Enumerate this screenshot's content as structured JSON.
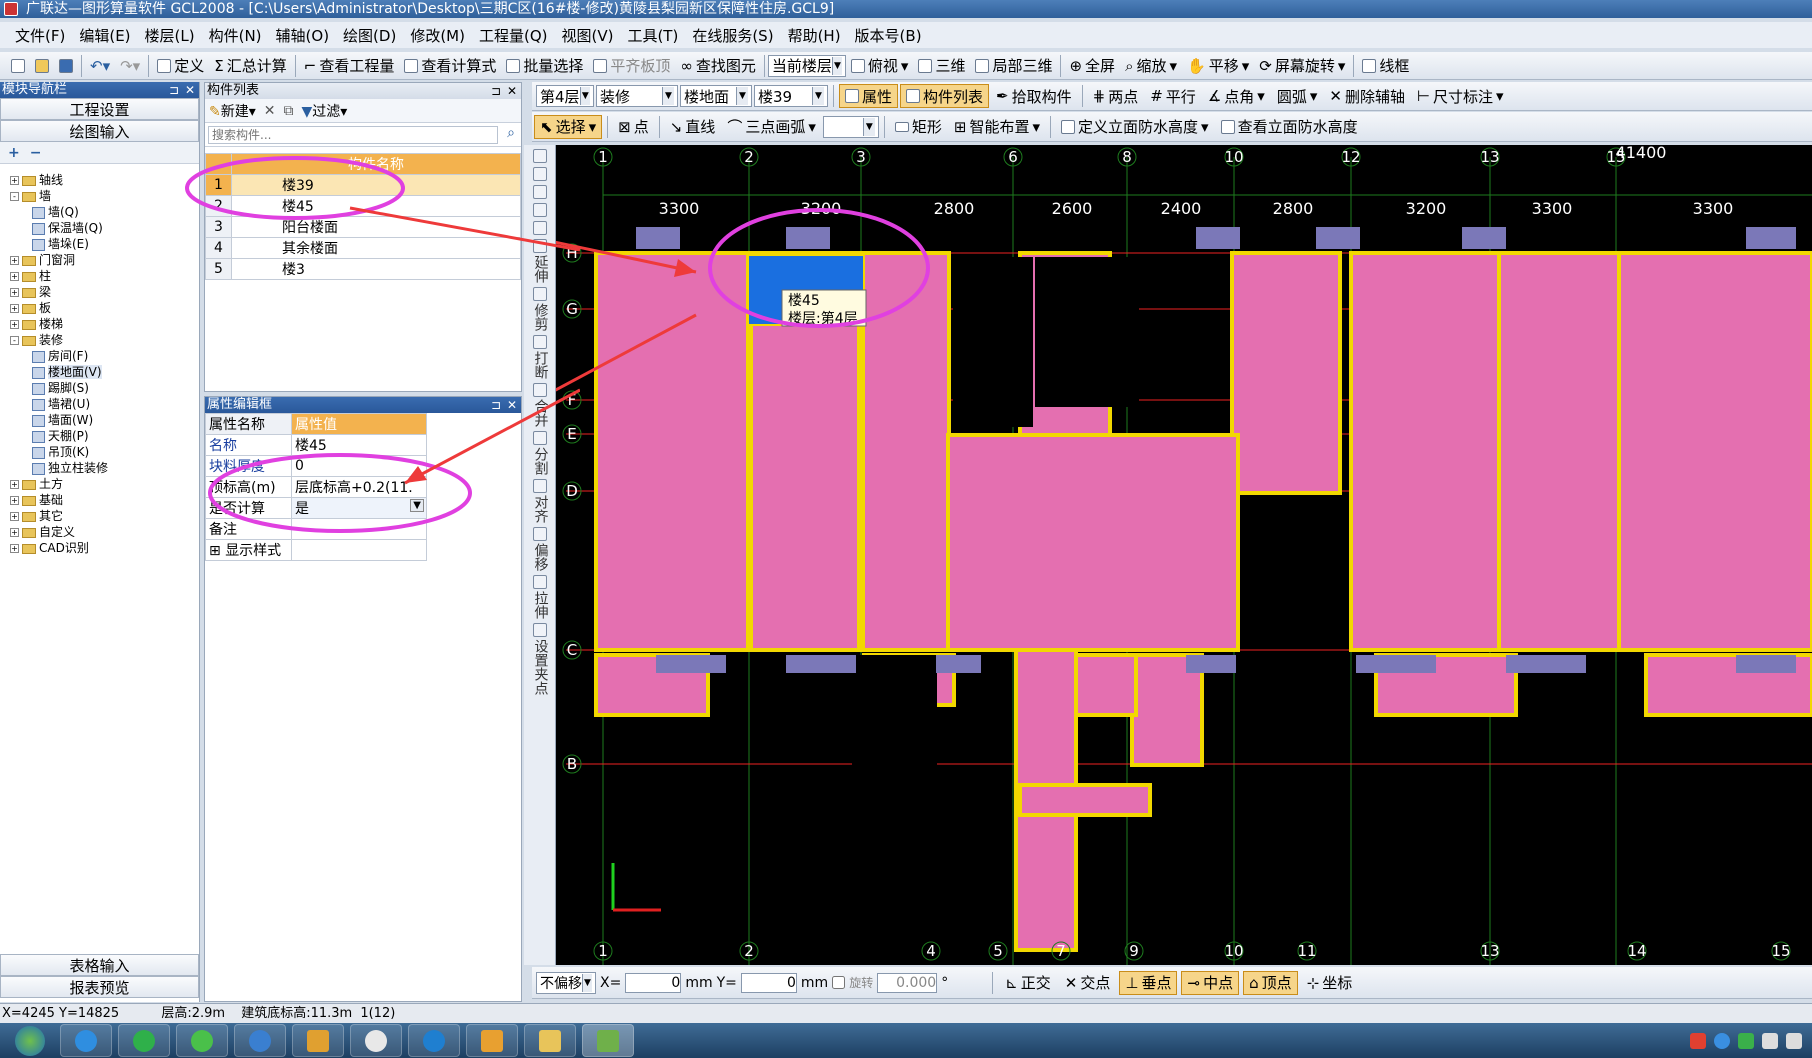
{
  "window": {
    "title": "广联达—图形算量软件 GCL2008 - [C:\\Users\\Administrator\\Desktop\\三期C区(16#楼-修改)黄陵县梨园新区保障性住房.GCL9]"
  },
  "menu": [
    "文件(F)",
    "编辑(E)",
    "楼层(L)",
    "构件(N)",
    "辅轴(O)",
    "绘图(D)",
    "修改(M)",
    "工程量(Q)",
    "视图(V)",
    "工具(T)",
    "在线服务(S)",
    "帮助(H)",
    "版本号(B)"
  ],
  "toolbar1": {
    "define": "定义",
    "sum": "汇总计算",
    "view_qty": "查看工程量",
    "view_formula": "查看计算式",
    "batch_select": "批量选择",
    "level_slab": "平齐板顶",
    "find_elem": "查找图元",
    "cur_floor": "当前楼层",
    "top_view": "俯视",
    "three_d": "三维",
    "local_3d": "局部三维",
    "full_screen": "全屏",
    "zoom": "缩放",
    "pan": "平移",
    "rotate": "屏幕旋转",
    "wireframe": "线框"
  },
  "toolbar2": {
    "floor": "第4层",
    "category": "装修",
    "type": "楼地面",
    "component": "楼39",
    "props": "属性",
    "comp_list": "构件列表",
    "pick": "拾取构件",
    "two_point": "两点",
    "parallel": "平行",
    "point_angle": "点角",
    "arc": "圆弧",
    "del_aux": "删除辅轴",
    "dim": "尺寸标注"
  },
  "toolbar3": {
    "select": "选择",
    "point": "点",
    "line": "直线",
    "arc3": "三点画弧",
    "rect": "矩形",
    "smart": "智能布置",
    "def_wp": "定义立面防水高度",
    "view_wp": "查看立面防水高度"
  },
  "nav": {
    "title": "模块导航栏",
    "project_settings": "工程设置",
    "drawing_input": "绘图输入",
    "table_input": "表格输入",
    "report_preview": "报表预览"
  },
  "tree": [
    {
      "label": "轴线",
      "level": 0,
      "exp": "+"
    },
    {
      "label": "墙",
      "level": 0,
      "exp": "-"
    },
    {
      "label": "墙(Q)",
      "level": 1
    },
    {
      "label": "保温墙(Q)",
      "level": 1
    },
    {
      "label": "墙垛(E)",
      "level": 1
    },
    {
      "label": "门窗洞",
      "level": 0,
      "exp": "+"
    },
    {
      "label": "柱",
      "level": 0,
      "exp": "+"
    },
    {
      "label": "梁",
      "level": 0,
      "exp": "+"
    },
    {
      "label": "板",
      "level": 0,
      "exp": "+"
    },
    {
      "label": "楼梯",
      "level": 0,
      "exp": "+"
    },
    {
      "label": "装修",
      "level": 0,
      "exp": "-"
    },
    {
      "label": "房间(F)",
      "level": 1
    },
    {
      "label": "楼地面(V)",
      "level": 1
    },
    {
      "label": "踢脚(S)",
      "level": 1
    },
    {
      "label": "墙裙(U)",
      "level": 1
    },
    {
      "label": "墙面(W)",
      "level": 1
    },
    {
      "label": "天棚(P)",
      "level": 1
    },
    {
      "label": "吊顶(K)",
      "level": 1
    },
    {
      "label": "独立柱装修",
      "level": 1
    },
    {
      "label": "土方",
      "level": 0,
      "exp": "+"
    },
    {
      "label": "基础",
      "level": 0,
      "exp": "+"
    },
    {
      "label": "其它",
      "level": 0,
      "exp": "+"
    },
    {
      "label": "自定义",
      "level": 0,
      "exp": "+"
    },
    {
      "label": "CAD识别",
      "level": 0,
      "exp": "+"
    }
  ],
  "complist": {
    "title": "构件列表",
    "new": "新建",
    "filter": "过滤",
    "search_placeholder": "搜索构件...",
    "col_name": "构件名称",
    "rows": [
      {
        "n": "1",
        "name": "楼39"
      },
      {
        "n": "2",
        "name": "楼45"
      },
      {
        "n": "3",
        "name": "阳台楼面"
      },
      {
        "n": "4",
        "name": "其余楼面"
      },
      {
        "n": "5",
        "name": "楼3"
      }
    ]
  },
  "props": {
    "title": "属性编辑框",
    "col_name": "属性名称",
    "col_value": "属性值",
    "rows": [
      {
        "name": "名称",
        "value": "楼45"
      },
      {
        "name": "块料厚度",
        "value": "0"
      },
      {
        "name": "顶标高(m)",
        "value": "层底标高+0.2(11."
      },
      {
        "name": "是否计算",
        "value": "是"
      },
      {
        "name": "备注",
        "value": ""
      },
      {
        "name": "显示样式",
        "value": ""
      }
    ]
  },
  "vtools": [
    "延伸",
    "修剪",
    "打断",
    "合并",
    "分割",
    "对齐",
    "偏移",
    "拉伸",
    "设置夹点"
  ],
  "drawing": {
    "top_axes": [
      "1",
      "2",
      "3",
      "6",
      "8",
      "10",
      "12",
      "13",
      "15"
    ],
    "bottom_axes": [
      "1",
      "2",
      "4",
      "5",
      "7",
      "9",
      "10",
      "11",
      "13",
      "14",
      "15"
    ],
    "dims": [
      "3300",
      "3200",
      "2800",
      "2600",
      "2400",
      "2800",
      "3200",
      "3300",
      "3300"
    ],
    "total": "41400",
    "rows": [
      "H",
      "G",
      "F",
      "E",
      "D",
      "C",
      "B"
    ],
    "tooltip_name": "楼45",
    "tooltip_floor": "楼层:第4层"
  },
  "bottombar": {
    "mode": "不偏移",
    "x_label": "X=",
    "x_val": "0",
    "mm": "mm",
    "y_label": "Y=",
    "y_val": "0",
    "rotate": "旋转",
    "rot_val": "0.000",
    "deg": "°",
    "ortho": "正交",
    "intersect": "交点",
    "perp": "垂点",
    "mid": "中点",
    "vertex": "顶点",
    "coord": "坐标"
  },
  "status": {
    "coords": "X=4245 Y=14825",
    "floor_height": "层高:2.9m",
    "base_elev": "建筑底标高:11.3m",
    "count": "1(12)"
  },
  "colors": {
    "room": "#e46fb0",
    "selected": "#1a6fe0",
    "annotation": "#e040e0",
    "arrow": "#ee3a3a",
    "grid": "#1e7b1e",
    "rowline": "#ee2222"
  }
}
